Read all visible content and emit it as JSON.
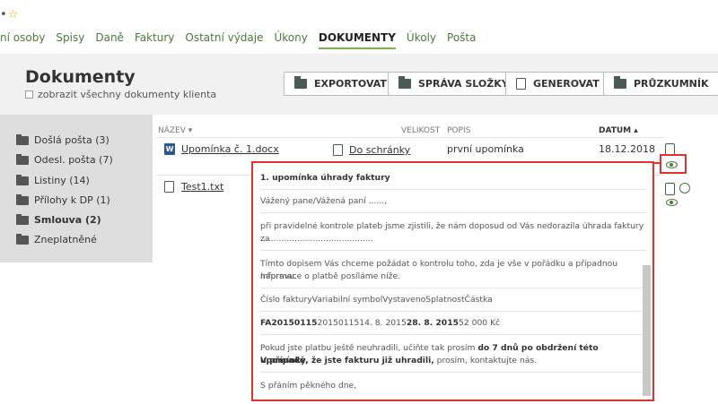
{
  "topbar": {
    "nav": [
      "ní osoby",
      "Spisy",
      "Daně",
      "Faktury",
      "Ostatní výdaje",
      "Úkony",
      "DOKUMENTY",
      "Úkoly",
      "Pošta"
    ],
    "active_index": 6
  },
  "header": {
    "title": "Dokumenty",
    "checkbox_label": "zobrazit všechny dokumenty klienta",
    "buttons": {
      "export": "EXPORTOVAT",
      "folder_mgmt": "SPRÁVA SLOŽKY",
      "generate": "GENEROVAT",
      "explorer": "PRŮZKUMNÍK"
    }
  },
  "sidebar": {
    "folders": [
      "Došlá pošta (3)",
      "Odesl. pošta (7)",
      "Listiny (14)",
      "Přílohy k DP (1)",
      "Smlouva (2)",
      "Zneplatněné"
    ],
    "selected_index": 4
  },
  "table": {
    "headers": {
      "name": "NÁZEV ▾",
      "size": "VELIKOST",
      "desc": "POPIS",
      "date": "DATUM ▴"
    },
    "rows": [
      {
        "name": "Upomínka č. 1.docx",
        "action": "Do schránky",
        "desc": "první upomínka",
        "date": "18.12.2018"
      },
      {
        "name": "Test1.txt",
        "action": "",
        "desc": "",
        "date": ""
      }
    ]
  },
  "preview": {
    "title": "1. upomínka úhrady faktury",
    "greeting": "Vážený pane/Vážená paní ......,",
    "para1": "při pravidelné kontrole plateb jsme zjistili, že nám doposud od Vás nedorazila úhrada faktury za",
    "para1_dots": "...........................................",
    "para2_l1": "Tímto dopisem Vás chceme požádat o kontrolu toho, zda je vše v pořádku a případnou nápravu.",
    "para2_l2": "Informace o platbě posíláme níže.",
    "table_header": "Číslo fakturyVariabilní symbolVystavenoSplatnostČástka",
    "row_a": "FA20150115",
    "row_b": "2015011514. 8. 2015",
    "row_c": "28. 8. 2015",
    "row_d": "52 000 Kč",
    "para3_a": "Pokud jste platbu ještě neuhradili, učiňte tak prosím ",
    "para3_b": "do 7 dnů po obdržení této upomínky.",
    "para4_a": "V případě, že jste fakturu již uhradili,",
    "para4_b": " prosím, kontaktujte nás.",
    "closing": "S přáním pěkného dne,"
  },
  "colors": {
    "accent_green": "#4a7a3a",
    "highlight_red": "#e53030",
    "active_underline": "#7cb342"
  }
}
